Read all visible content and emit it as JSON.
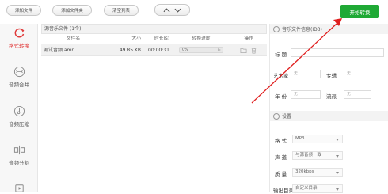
{
  "toolbar": {
    "add_file": "添加文件",
    "add_folder": "添加文件夹",
    "clear_list": "清空列表",
    "start": "开始转换"
  },
  "sidebar": {
    "items": [
      {
        "label": "格式转换",
        "icon": "refresh-icon",
        "active": true
      },
      {
        "label": "音频合并",
        "icon": "merge-icon"
      },
      {
        "label": "音频压缩",
        "icon": "compress-icon"
      },
      {
        "label": "音频分割",
        "icon": "split-icon"
      }
    ]
  },
  "file_panel": {
    "header": "源音乐文件 (1个)",
    "columns": [
      "文件名",
      "大小",
      "时长(s)",
      "转换进度",
      "操作"
    ],
    "rows": [
      {
        "name": "测试音频.amr",
        "size": "49.85 KB",
        "duration": "00:00:31",
        "progress": "0%"
      }
    ]
  },
  "info": {
    "title": "音乐文件信息(ID3)",
    "title_label": "标  题",
    "artist_label": "艺术家",
    "artist_placeholder": "无",
    "album_label": "专辑",
    "album_placeholder": "无",
    "year_label": "年  份",
    "year_placeholder": "无",
    "genre_label": "流派",
    "genre_placeholder": "无"
  },
  "settings": {
    "title": "设置",
    "format_label": "格  式",
    "format_value": "MP3",
    "channel_label": "声  道",
    "channel_value": "与源音频一致",
    "quality_label": "质  量",
    "quality_value": "320kbps",
    "output_label": "输出目录",
    "output_value": "自定义目录"
  },
  "colors": {
    "accent_green": "#1fa935",
    "active_red": "#e03a3a",
    "arrow_red": "#e02020"
  }
}
